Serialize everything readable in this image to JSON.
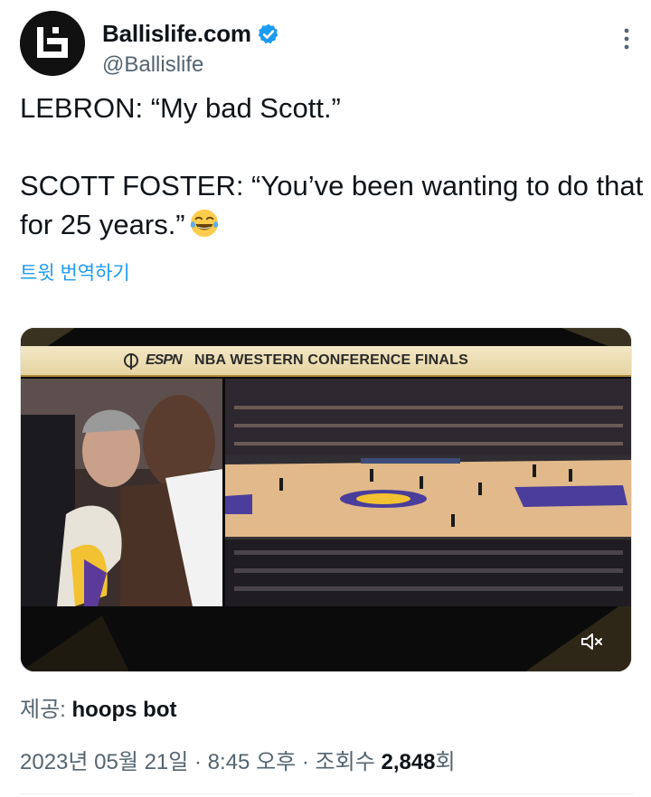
{
  "author": {
    "display_name": "Ballislife.com",
    "handle": "@Ballislife",
    "verified": true,
    "avatar_icon": "ballislife-logo-icon"
  },
  "tweet": {
    "text": "LEBRON: “My bad Scott.”\n\nSCOTT FOSTER: “You’ve been wanting to do that for 25 years.”",
    "emoji": "face-with-tears-of-joy-emoji",
    "translate_label": "트윗 번역하기"
  },
  "media": {
    "type": "video",
    "banner_network": "ESPN",
    "banner_title": "NBA WESTERN CONFERENCE FINALS",
    "mute_icon": "speaker-muted-icon"
  },
  "credit": {
    "label": "제공:",
    "name": "hoops bot"
  },
  "meta": {
    "date_time": "2023년 05월 21일 · 8:45 오후 · 조회수 ",
    "views": "2,848",
    "views_suffix": "회"
  },
  "colors": {
    "accent": "#1d9bf0",
    "text": "#0f1419",
    "secondary": "#536471"
  }
}
